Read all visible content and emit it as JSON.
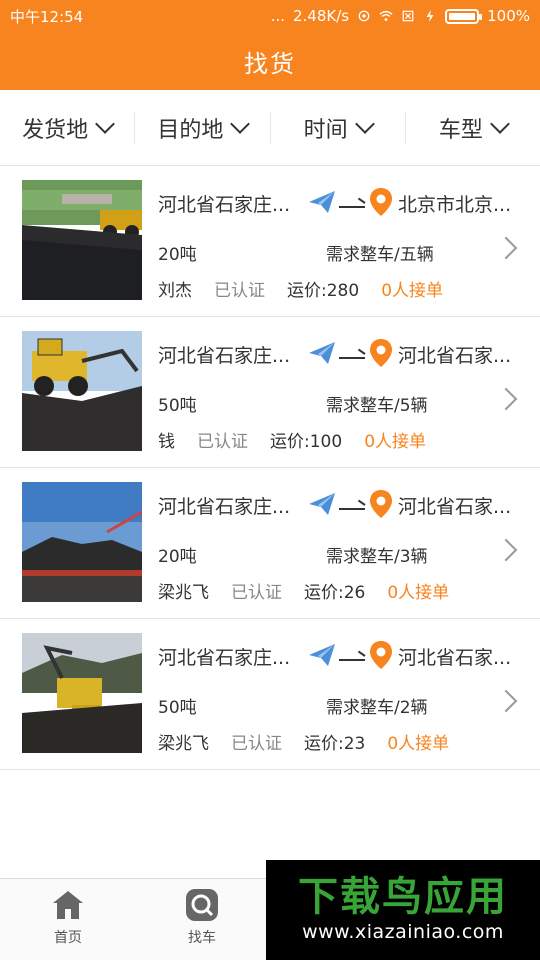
{
  "status_bar": {
    "time": "中午12:54",
    "signal_dots": "...",
    "speed": "2.48K/s",
    "battery": "100%"
  },
  "header": {
    "title": "找货"
  },
  "filters": [
    {
      "label": "发货地"
    },
    {
      "label": "目的地"
    },
    {
      "label": "时间"
    },
    {
      "label": "车型"
    }
  ],
  "listings": [
    {
      "origin": "河北省石家庄...",
      "destination": "北京市北京...",
      "weight": "20吨",
      "demand": "需求整车/五辆",
      "person": "刘杰",
      "verified": "已认证",
      "price": "运价:280",
      "takers": "0人接单"
    },
    {
      "origin": "河北省石家庄...",
      "destination": "河北省石家...",
      "weight": "50吨",
      "demand": "需求整车/5辆",
      "person": "钱",
      "verified": "已认证",
      "price": "运价:100",
      "takers": "0人接单"
    },
    {
      "origin": "河北省石家庄...",
      "destination": "河北省石家...",
      "weight": "20吨",
      "demand": "需求整车/3辆",
      "person": "梁兆飞",
      "verified": "已认证",
      "price": "运价:26",
      "takers": "0人接单"
    },
    {
      "origin": "河北省石家庄...",
      "destination": "河北省石家...",
      "weight": "50吨",
      "demand": "需求整车/2辆",
      "person": "梁兆飞",
      "verified": "已认证",
      "price": "运价:23",
      "takers": "0人接单"
    }
  ],
  "tabs": [
    {
      "label": "首页",
      "icon": "home-icon"
    },
    {
      "label": "找车",
      "icon": "search-icon"
    }
  ],
  "watermark": {
    "title": "下载鸟应用",
    "url": "www.xiazainiao.com"
  },
  "colors": {
    "accent": "#f7841e",
    "plane_blue": "#4a8fd8",
    "takers_orange": "#f7841e"
  }
}
